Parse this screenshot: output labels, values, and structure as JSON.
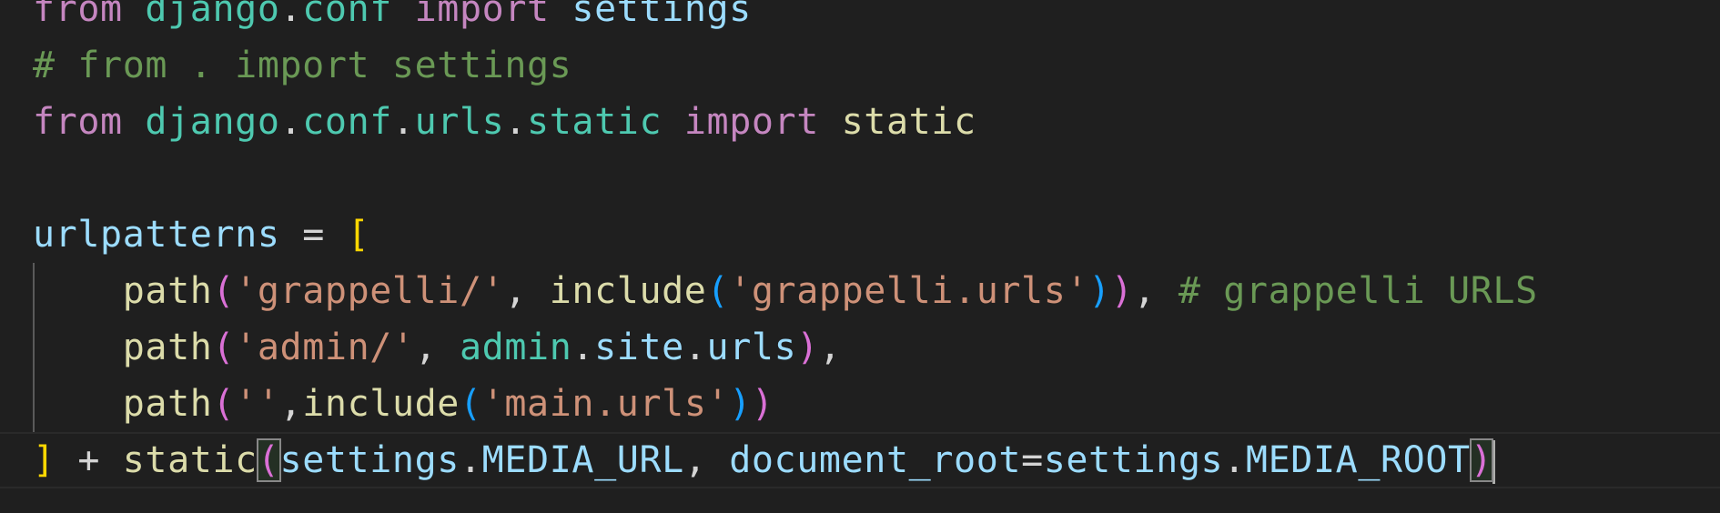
{
  "editor": {
    "language": "python",
    "current_line": 8,
    "lines": [
      {
        "tokens": [
          [
            "from",
            "kw"
          ],
          [
            " ",
            ""
          ],
          [
            "django",
            "mod"
          ],
          [
            ".",
            "op"
          ],
          [
            "conf",
            "mod"
          ],
          [
            " ",
            ""
          ],
          [
            "import",
            "kw"
          ],
          [
            " ",
            ""
          ],
          [
            "settings",
            "var"
          ]
        ]
      },
      {
        "tokens": [
          [
            "# from . import settings",
            "cm"
          ]
        ]
      },
      {
        "tokens": [
          [
            "from",
            "kw"
          ],
          [
            " ",
            ""
          ],
          [
            "django",
            "mod"
          ],
          [
            ".",
            "op"
          ],
          [
            "conf",
            "mod"
          ],
          [
            ".",
            "op"
          ],
          [
            "urls",
            "mod"
          ],
          [
            ".",
            "op"
          ],
          [
            "static",
            "mod"
          ],
          [
            " ",
            ""
          ],
          [
            "import",
            "kw"
          ],
          [
            " ",
            ""
          ],
          [
            "static",
            "fn"
          ]
        ]
      },
      {
        "tokens": []
      },
      {
        "tokens": [
          [
            "urlpatterns",
            "var"
          ],
          [
            " = ",
            "op"
          ],
          [
            "[",
            "b1"
          ]
        ]
      },
      {
        "guide": true,
        "tokens": [
          [
            "    ",
            ""
          ],
          [
            "path",
            "fn"
          ],
          [
            "(",
            "b2"
          ],
          [
            "'grappelli/'",
            "str"
          ],
          [
            ", ",
            "op"
          ],
          [
            "include",
            "fn"
          ],
          [
            "(",
            "b3"
          ],
          [
            "'grappelli.urls'",
            "str"
          ],
          [
            ")",
            "b3"
          ],
          [
            ")",
            "b2"
          ],
          [
            ", ",
            "op"
          ],
          [
            "# grappelli URLS",
            "cm"
          ]
        ]
      },
      {
        "guide": true,
        "tokens": [
          [
            "    ",
            ""
          ],
          [
            "path",
            "fn"
          ],
          [
            "(",
            "b2"
          ],
          [
            "'admin/'",
            "str"
          ],
          [
            ", ",
            "op"
          ],
          [
            "admin",
            "mod"
          ],
          [
            ".",
            "op"
          ],
          [
            "site",
            "var"
          ],
          [
            ".",
            "op"
          ],
          [
            "urls",
            "var"
          ],
          [
            ")",
            "b2"
          ],
          [
            ",",
            "op"
          ]
        ]
      },
      {
        "guide": true,
        "tokens": [
          [
            "    ",
            ""
          ],
          [
            "path",
            "fn"
          ],
          [
            "(",
            "b2"
          ],
          [
            "''",
            "str"
          ],
          [
            ",",
            "op"
          ],
          [
            "include",
            "fn"
          ],
          [
            "(",
            "b3"
          ],
          [
            "'main.urls'",
            "str"
          ],
          [
            ")",
            "b3"
          ],
          [
            ")",
            "b2"
          ]
        ]
      },
      {
        "tokens": [
          [
            "]",
            "b1"
          ],
          [
            " + ",
            "op"
          ],
          [
            "static",
            "fn"
          ],
          [
            "(",
            "b2 match"
          ],
          [
            "settings",
            "var"
          ],
          [
            ".",
            "op"
          ],
          [
            "MEDIA_URL",
            "var"
          ],
          [
            ", ",
            "op"
          ],
          [
            "document_root",
            "var"
          ],
          [
            "=",
            "op"
          ],
          [
            "settings",
            "var"
          ],
          [
            ".",
            "op"
          ],
          [
            "MEDIA_ROOT",
            "var"
          ],
          [
            ")",
            "b2 match"
          ],
          [
            "",
            "cursor"
          ]
        ]
      }
    ]
  }
}
